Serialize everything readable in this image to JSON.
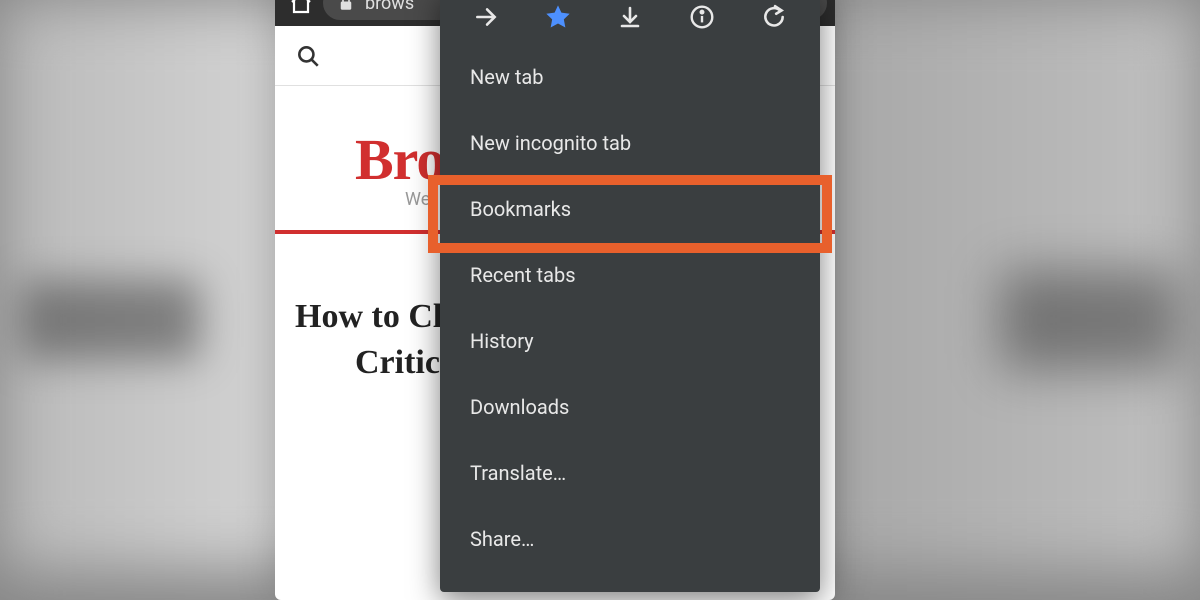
{
  "addressbar": {
    "text": "brows"
  },
  "page": {
    "brand_title": "Bro",
    "brand_sub": "We",
    "heading_line1": "How to Cl",
    "heading_line2": "Critica"
  },
  "menu": {
    "items": [
      "New tab",
      "New incognito tab",
      "Bookmarks",
      "Recent tabs",
      "History",
      "Downloads",
      "Translate…",
      "Share…"
    ]
  }
}
